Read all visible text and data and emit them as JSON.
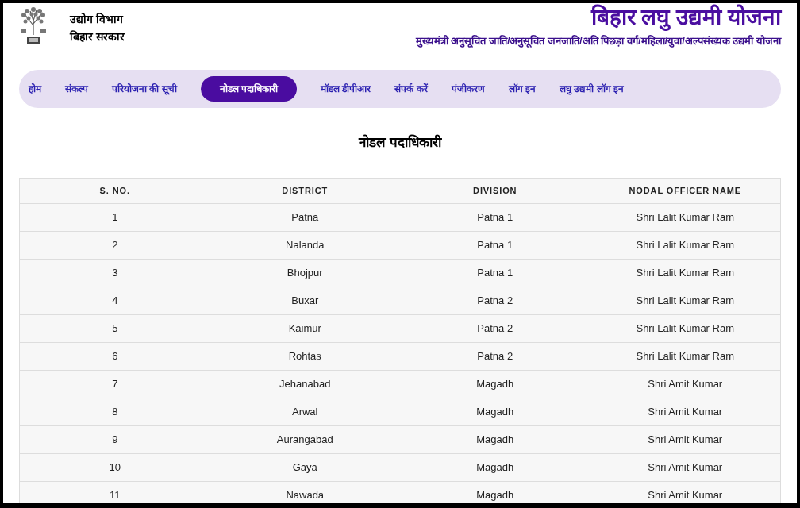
{
  "header": {
    "department": "उद्योग विभाग",
    "government": "बिहार सरकार",
    "title": "बिहार लघु उद्यमी योजना",
    "subtitle": "मुख्यमंत्री अनुसूचित जाति/अनुसूचित जनजाति/अति पिछड़ा वर्ग/महिला/युवा/अल्पसंख्यक उद्यमी योजना"
  },
  "nav": [
    {
      "label": "होम",
      "selected": false
    },
    {
      "label": "संकल्प",
      "selected": false
    },
    {
      "label": "परियोजना की सूची",
      "selected": false
    },
    {
      "label": "नोडल पदाधिकारी",
      "selected": true
    },
    {
      "label": "मॉडल डीपीआर",
      "selected": false
    },
    {
      "label": "संपर्क करें",
      "selected": false
    },
    {
      "label": "पंजीकरण",
      "selected": false
    },
    {
      "label": "लॉग इन",
      "selected": false
    },
    {
      "label": "लघु उद्यमी लॉग इन",
      "selected": false
    }
  ],
  "page_title": "नोडल पदाधिकारी",
  "table": {
    "columns": [
      "S. NO.",
      "DISTRICT",
      "DIVISION",
      "NODAL OFFICER NAME"
    ],
    "rows": [
      [
        "1",
        "Patna",
        "Patna 1",
        "Shri Lalit Kumar Ram"
      ],
      [
        "2",
        "Nalanda",
        "Patna 1",
        "Shri Lalit Kumar Ram"
      ],
      [
        "3",
        "Bhojpur",
        "Patna 1",
        "Shri Lalit Kumar Ram"
      ],
      [
        "4",
        "Buxar",
        "Patna 2",
        "Shri Lalit Kumar Ram"
      ],
      [
        "5",
        "Kaimur",
        "Patna 2",
        "Shri Lalit Kumar Ram"
      ],
      [
        "6",
        "Rohtas",
        "Patna 2",
        "Shri Lalit Kumar Ram"
      ],
      [
        "7",
        "Jehanabad",
        "Magadh",
        "Shri Amit Kumar"
      ],
      [
        "8",
        "Arwal",
        "Magadh",
        "Shri Amit Kumar"
      ],
      [
        "9",
        "Aurangabad",
        "Magadh",
        "Shri Amit Kumar"
      ],
      [
        "10",
        "Gaya",
        "Magadh",
        "Shri Amit Kumar"
      ],
      [
        "11",
        "Nawada",
        "Magadh",
        "Shri Amit Kumar"
      ]
    ]
  }
}
